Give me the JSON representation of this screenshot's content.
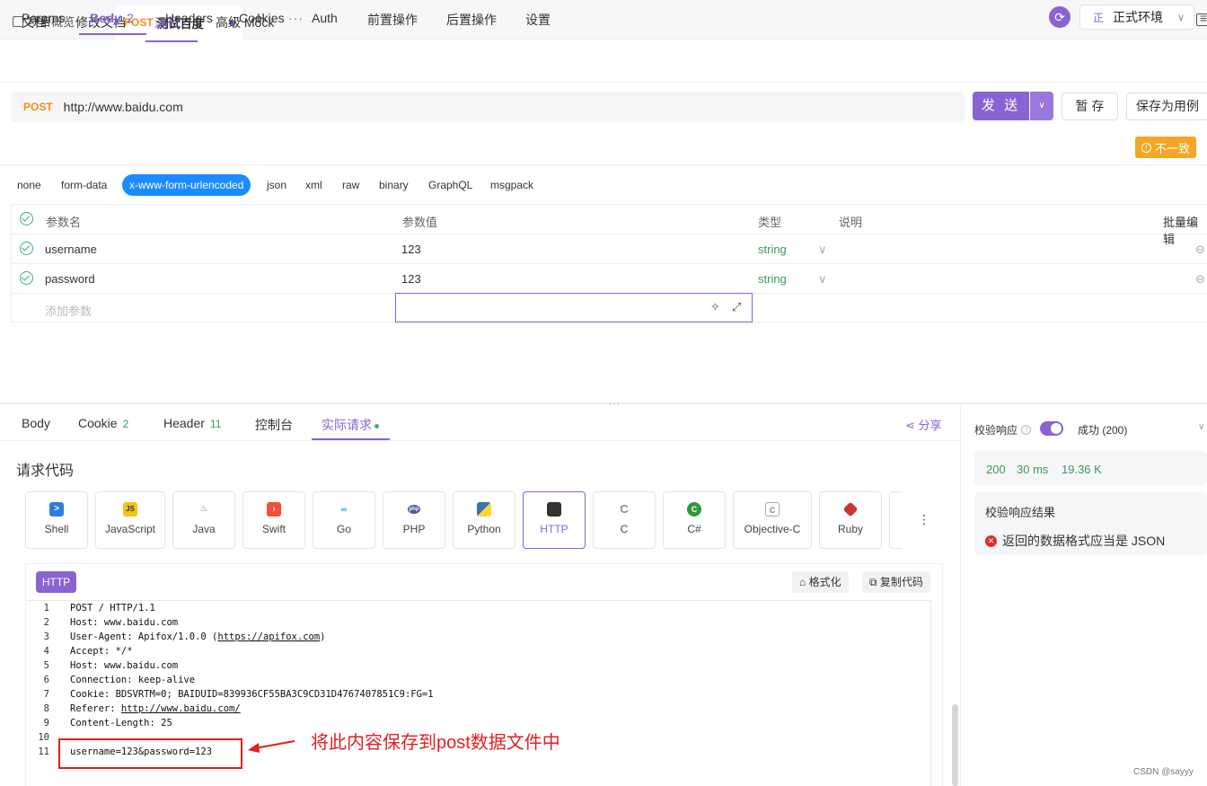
{
  "topbar": {
    "overview_label": "项目概览",
    "tab_method": "POST",
    "tab_title": "测试百度",
    "env_prefix": "正",
    "env_name": "正式环境"
  },
  "subtabs": [
    "文档",
    "修改文档",
    "运行",
    "高级 Mock"
  ],
  "request": {
    "method": "POST",
    "url": "http://www.baidu.com",
    "send_label": "发 送",
    "save_temp_label": "暂 存",
    "save_case_label": "保存为用例"
  },
  "req_tabs": [
    "Params",
    "Body",
    "Headers",
    "Cookies",
    "Auth",
    "前置操作",
    "后置操作",
    "设置"
  ],
  "body_count": "2",
  "warn_label": "不一致",
  "body_types": [
    "none",
    "form-data",
    "x-www-form-urlencoded",
    "json",
    "xml",
    "raw",
    "binary",
    "GraphQL",
    "msgpack"
  ],
  "params_table": {
    "headers": [
      "参数名",
      "参数值",
      "类型",
      "说明",
      "批量编辑"
    ],
    "rows": [
      {
        "name": "username",
        "value": "123",
        "type": "string"
      },
      {
        "name": "password",
        "value": "123",
        "type": "string"
      }
    ],
    "add_placeholder": "添加参数"
  },
  "resp_tabs": {
    "body": "Body",
    "cookie": "Cookie",
    "cookie_count": "2",
    "header": "Header",
    "header_count": "11",
    "console": "控制台",
    "actual": "实际请求"
  },
  "share_label": "分享",
  "request_code_title": "请求代码",
  "languages": [
    "Shell",
    "JavaScript",
    "Java",
    "Swift",
    "Go",
    "PHP",
    "Python",
    "HTTP",
    "C",
    "C#",
    "Objective-C",
    "Ruby"
  ],
  "code": {
    "badge": "HTTP",
    "format_label": "格式化",
    "copy_label": "复制代码",
    "lines": [
      "POST / HTTP/1.1",
      "Host: www.baidu.com",
      "User-Agent: Apifox/1.0.0 (",
      "Accept: */*",
      "Host: www.baidu.com",
      "Connection: keep-alive",
      "Cookie: BDSVRTM=0; BAIDUID=839936CF55BA3C9CD31D4767407851C9:FG=1",
      "Referer: ",
      "Content-Length: 25",
      "",
      "username=123&password=123"
    ],
    "link_apifox": "https://apifox.com",
    "link_close": ")",
    "link_referer": "http://www.baidu.com/"
  },
  "annotation": "将此内容保存到post数据文件中",
  "validation": {
    "label": "校验响应",
    "status": "成功 (200)",
    "code": "200",
    "time": "30 ms",
    "size": "19.36 K",
    "result_title": "校验响应结果",
    "error_text": "返回的数据格式应当是 JSON"
  },
  "watermark": "CSDN @sayyy",
  "colors": {
    "accent": "#8a63d2",
    "method": "#f28c1e",
    "success": "#3a9a5a",
    "error": "#e02020",
    "blue_chip": "#1a8cff"
  }
}
